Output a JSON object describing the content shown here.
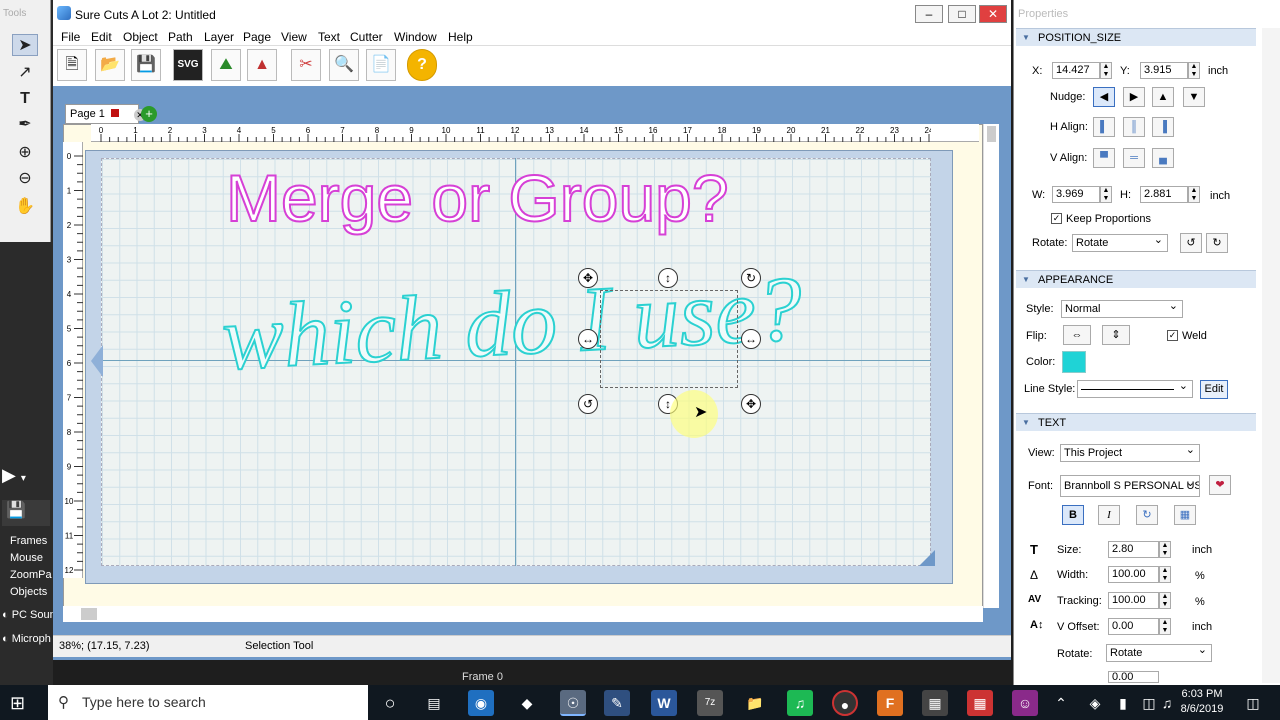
{
  "left_strip": {
    "tools_title": "Tools",
    "items": [
      "Frames",
      "Mouse",
      "ZoomPa",
      "Objects",
      "PC Soun",
      "Microph"
    ]
  },
  "app": {
    "title": "Sure Cuts A Lot 2: Untitled",
    "menu": [
      "File",
      "Edit",
      "Object",
      "Path",
      "Layer",
      "Page",
      "View",
      "Text",
      "Cutter",
      "Window",
      "Help"
    ],
    "toolbar_svg_label": "SVG",
    "page_tab": "Page 1",
    "design_heading": "Merge or Group?",
    "design_script": "which do I use?",
    "ruler_h": [
      "0",
      "1",
      "2",
      "3",
      "4",
      "5",
      "6",
      "7",
      "8",
      "9",
      "10",
      "11",
      "12",
      "13",
      "14",
      "15",
      "16",
      "17",
      "18",
      "19",
      "20",
      "21",
      "22",
      "23",
      "24"
    ],
    "ruler_v": [
      "0",
      "1",
      "2",
      "3",
      "4",
      "5",
      "6",
      "7",
      "8",
      "9",
      "10",
      "11",
      "12"
    ],
    "status_coords": "38%; (17.15, 7.23)",
    "status_tool": "Selection Tool",
    "frame_label": "Frame 0"
  },
  "properties": {
    "title": "Properties",
    "position_size": {
      "header": "POSITION_SIZE",
      "x_label": "X:",
      "x_value": "14.427",
      "y_label": "Y:",
      "y_value": "3.915",
      "unit": "inch",
      "nudge_label": "Nudge:",
      "halign_label": "H Align:",
      "valign_label": "V Align:",
      "w_label": "W:",
      "w_value": "3.969",
      "h_label": "H:",
      "h_value": "2.881",
      "keep_proportions": "Keep Proportions",
      "rotate_label": "Rotate:",
      "rotate_value": "Rotate"
    },
    "appearance": {
      "header": "APPEARANCE",
      "style_label": "Style:",
      "style_value": "Normal",
      "flip_label": "Flip:",
      "weld_label": "Weld",
      "color_label": "Color:",
      "color_value": "#1fd3d6",
      "line_style_label": "Line Style:",
      "edit_button": "Edit"
    },
    "text": {
      "header": "TEXT",
      "view_label": "View:",
      "view_value": "This Project",
      "font_label": "Font:",
      "font_value": "Brannboll S PERSONAL US",
      "bold": "B",
      "italic": "I",
      "size_label": "Size:",
      "size_value": "2.80",
      "size_unit": "inch",
      "width_label": "Width:",
      "width_value": "100.00",
      "width_unit": "%",
      "tracking_label": "Tracking:",
      "tracking_value": "100.00",
      "tracking_unit": "%",
      "voffset_label": "V Offset:",
      "voffset_value": "0.00",
      "voffset_unit": "inch",
      "rotate_label": "Rotate:",
      "rotate_value": "Rotate",
      "partial_value": "0.00"
    }
  },
  "taskbar": {
    "search_placeholder": "Type here to search",
    "time": "6:03 PM",
    "date": "8/6/2019"
  },
  "colors": {
    "heading_stroke": "#d640d6",
    "script_stroke": "#2bd1d1",
    "panel_header": "#dce7f4"
  }
}
